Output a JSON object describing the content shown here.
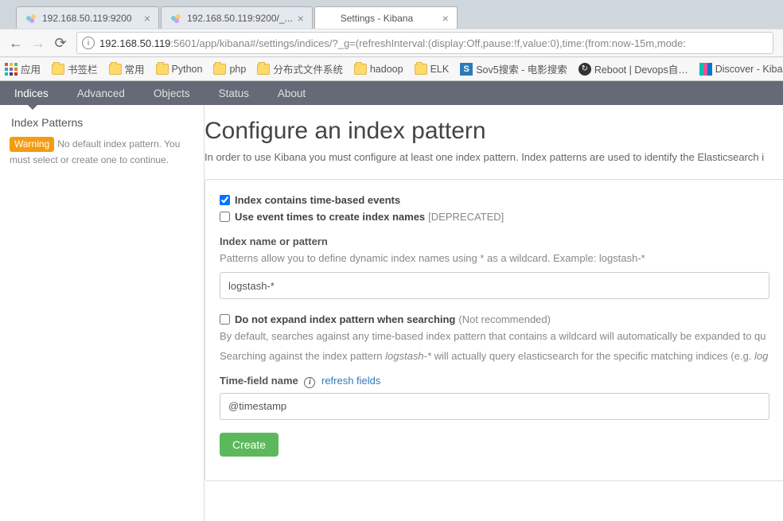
{
  "browser": {
    "tabs": [
      {
        "title": "192.168.50.119:9200"
      },
      {
        "title": "192.168.50.119:9200/_..."
      },
      {
        "title": "Settings - Kibana"
      }
    ],
    "url_host": "192.168.50.119",
    "url_path": ":5601/app/kibana#/settings/indices/?_g=(refreshInterval:(display:Off,pause:!f,value:0),time:(from:now-15m,mode:"
  },
  "bookmarks": {
    "apps": "应用",
    "items": [
      "书签栏",
      "常用",
      "Python",
      "php",
      "分布式文件系统",
      "hadoop",
      "ELK"
    ],
    "sov5": "Sov5搜索 - 电影搜索",
    "reboot": "Reboot | Devops自…",
    "discover": "Discover - Kiba"
  },
  "nav": {
    "items": [
      "Indices",
      "Advanced",
      "Objects",
      "Status",
      "About"
    ]
  },
  "sidebar": {
    "heading": "Index Patterns",
    "warn_badge": "Warning",
    "warn_text": "No default index pattern. You must select or create one to continue."
  },
  "main": {
    "title": "Configure an index pattern",
    "subtitle": "In order to use Kibana you must configure at least one index pattern. Index patterns are used to identify the Elasticsearch i",
    "chk_time": "Index contains time-based events",
    "chk_event": "Use event times to create index names",
    "chk_event_dep": "[DEPRECATED]",
    "field_name_label": "Index name or pattern",
    "field_name_help": "Patterns allow you to define dynamic index names using * as a wildcard. Example: logstash-*",
    "field_name_value": "logstash-*",
    "chk_expand": "Do not expand index pattern when searching",
    "chk_expand_note": "(Not recommended)",
    "expand_help1": "By default, searches against any time-based index pattern that contains a wildcard will automatically be expanded to qu",
    "expand_help2a": "Searching against the index pattern ",
    "expand_help2_em": "logstash-*",
    "expand_help2b": " will actually query elasticsearch for the specific matching indices (e.g. ",
    "expand_help2_em2": "log",
    "time_field_label": "Time-field name",
    "refresh_link": "refresh fields",
    "time_field_value": "@timestamp",
    "create_btn": "Create"
  }
}
